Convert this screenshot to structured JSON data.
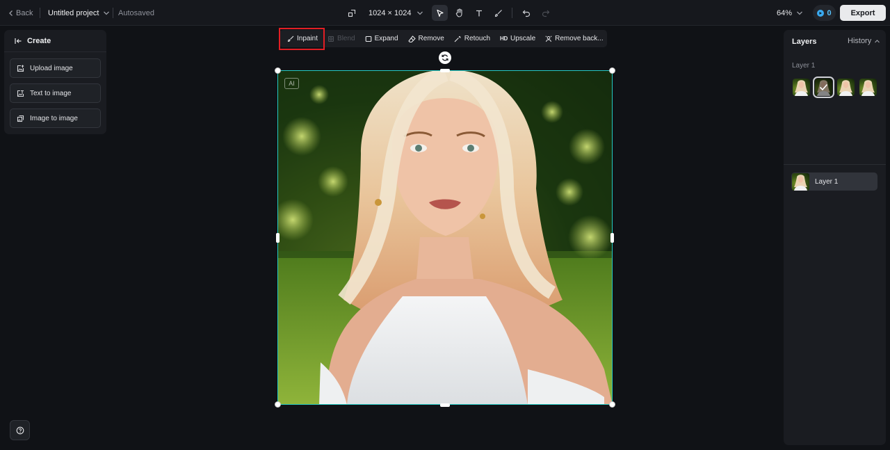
{
  "header": {
    "back_label": "Back",
    "project_name": "Untitled project",
    "save_status": "Autosaved",
    "canvas_size": "1024 × 1024",
    "zoom": "64%",
    "credits": "0",
    "export_label": "Export"
  },
  "tools": [
    {
      "name": "select-tool",
      "icon": "cursor-arrow-icon",
      "active": true
    },
    {
      "name": "hand-tool",
      "icon": "hand-icon",
      "active": false
    },
    {
      "name": "text-tool",
      "icon": "text-t-icon",
      "active": false
    },
    {
      "name": "brush-tool",
      "icon": "brush-icon",
      "active": false
    },
    {
      "name": "undo-button",
      "icon": "undo-icon",
      "active": false
    },
    {
      "name": "redo-button",
      "icon": "redo-icon",
      "active": false,
      "disabled": true
    }
  ],
  "left_panel": {
    "title": "Create",
    "items": [
      {
        "label": "Upload image",
        "icon": "upload-image-icon"
      },
      {
        "label": "Text to image",
        "icon": "text-to-image-icon"
      },
      {
        "label": "Image to image",
        "icon": "image-to-image-icon"
      }
    ]
  },
  "edit_toolbar": {
    "items": [
      {
        "label": "Inpaint",
        "icon": "inpaint-brush-icon",
        "highlighted": true
      },
      {
        "label": "Blend",
        "icon": "blend-icon",
        "disabled": true
      },
      {
        "label": "Expand",
        "icon": "expand-icon"
      },
      {
        "label": "Remove",
        "icon": "eraser-icon"
      },
      {
        "label": "Retouch",
        "icon": "magic-wand-icon"
      },
      {
        "label": "Upscale",
        "icon_text": "HD"
      },
      {
        "label": "Remove back...",
        "icon": "remove-background-icon"
      }
    ]
  },
  "canvas": {
    "ai_badge": "AI"
  },
  "right_panel": {
    "title": "Layers",
    "history_label": "History",
    "section_label": "Layer 1",
    "thumbnails_count": 4,
    "selected_thumbnail": 2,
    "layers": [
      {
        "name": "Layer 1"
      }
    ]
  },
  "colors": {
    "background": "#101216",
    "panel": "#1a1c21",
    "selection": "#25c9c3",
    "highlight": "#e21e24",
    "credits_accent": "#3aaaf0"
  }
}
